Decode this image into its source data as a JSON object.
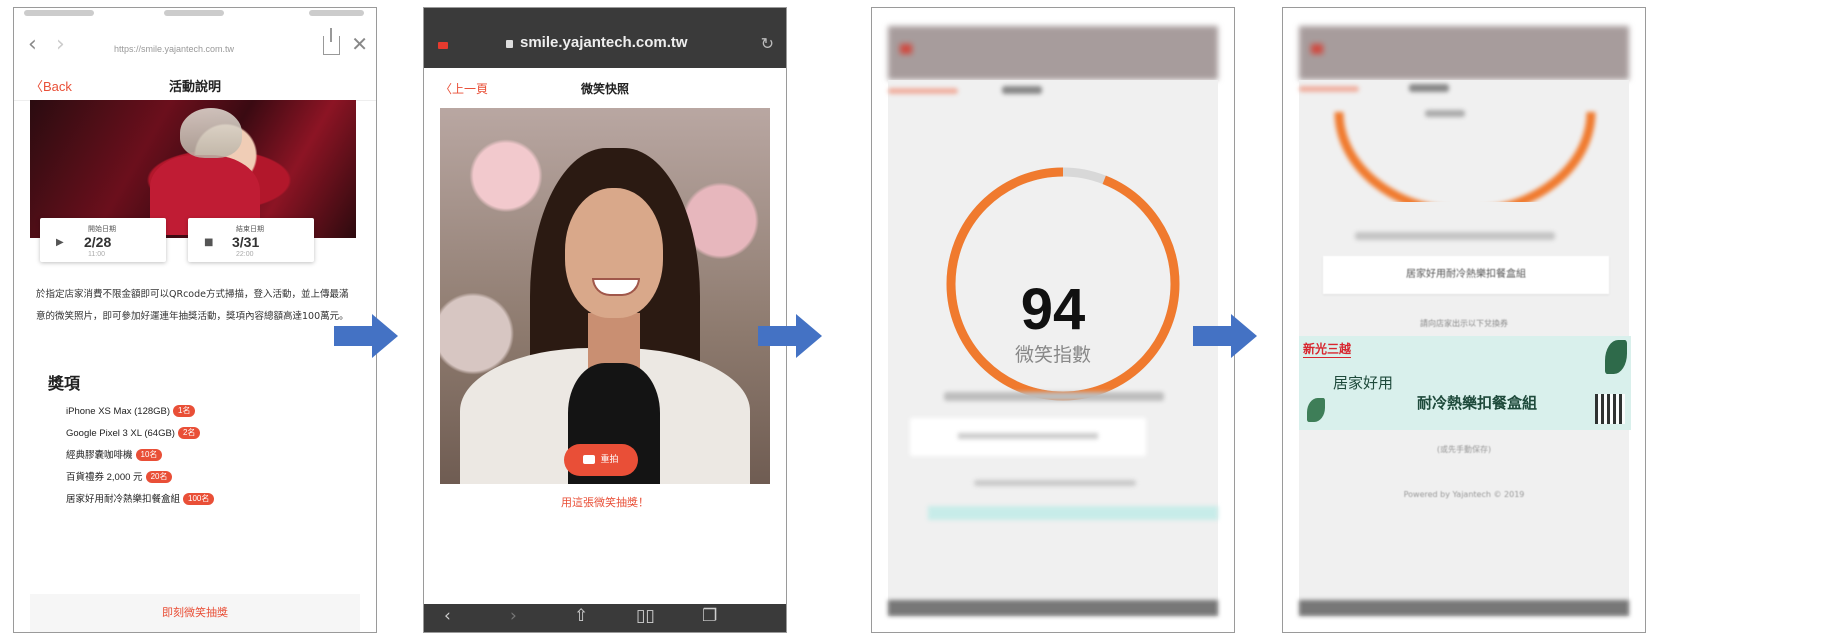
{
  "colors": {
    "accent": "#e94f37",
    "arrow": "#4472c4",
    "ring": "#f07a2e"
  },
  "screen1": {
    "url": "https://smile.yajantech.com.tw",
    "back": "Back",
    "title": "活動說明",
    "start_label": "開始日期",
    "start_date": "2/28",
    "start_time": "11:00",
    "end_label": "結束日期",
    "end_date": "3/31",
    "end_time": "22:00",
    "description": "於指定店家消費不限金額即可以QRcode方式掃描，登入活動，並上傳最滿意的微笑照片，即可參加好運連年抽獎活動，獎項內容總額高達100萬元。",
    "prize_heading": "獎項",
    "prizes": [
      {
        "name": "iPhone XS Max (128GB)",
        "qty": "1名"
      },
      {
        "name": "Google Pixel 3 XL (64GB)",
        "qty": "2名"
      },
      {
        "name": "經典膠囊咖啡機",
        "qty": "10名"
      },
      {
        "name": "百貨禮券 2,000 元",
        "qty": "20名"
      },
      {
        "name": "居家好用耐冷熱樂扣餐盒組",
        "qty": "100名"
      }
    ],
    "footer": "即刻微笑抽獎"
  },
  "screen2": {
    "url": "smile.yajantech.com.tw",
    "back": "上一頁",
    "title": "微笑快照",
    "retake": "重拍",
    "caption": "用這張微笑抽獎！"
  },
  "screen3": {
    "score": "94",
    "score_label": "微笑指數",
    "score_fraction": 0.94
  },
  "screen4": {
    "prize_card": "居家好用耐冷熱樂扣餐盒組",
    "note": "請向店家出示以下兌換券",
    "brand": "新光三越",
    "voucher_line1": "居家好用",
    "voucher_line2": "耐冷熱樂扣餐盒組",
    "saved": "(或先手動保存)",
    "powered": "Powered by Yajantech © 2019"
  }
}
